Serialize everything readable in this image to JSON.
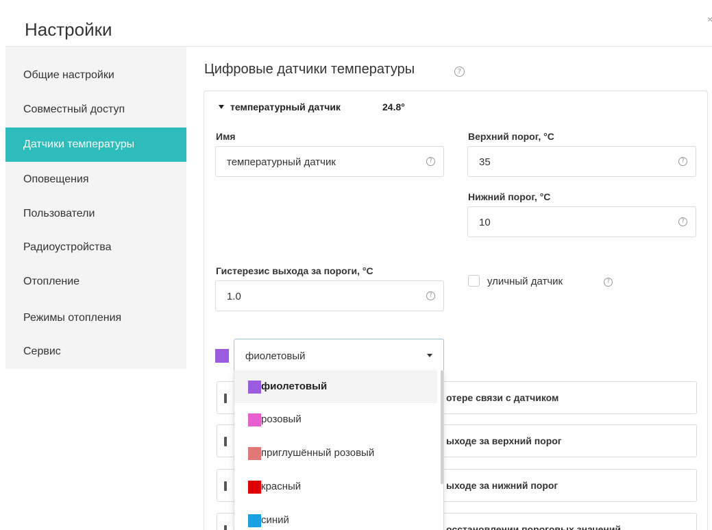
{
  "dialog": {
    "title": "Настройки",
    "close_icon": "close-icon"
  },
  "sidebar": {
    "items": [
      {
        "label": "Общие настройки",
        "active": false
      },
      {
        "label": "Совместный доступ",
        "active": false
      },
      {
        "label": "Датчики температуры",
        "active": true
      },
      {
        "label": "Оповещения",
        "active": false
      },
      {
        "label": "Пользователи",
        "active": false
      },
      {
        "label": "Радиоустройства",
        "active": false
      },
      {
        "label": "Отопление",
        "active": false
      },
      {
        "label": "Режимы отопления",
        "active": false
      },
      {
        "label": "Сервис",
        "active": false
      }
    ],
    "active_color": "#2dbdbd"
  },
  "main": {
    "title": "Цифровые датчики температуры",
    "sensor": {
      "name_header": "температурный датчик",
      "temperature": "24.8°",
      "name_label": "Имя",
      "name_value": "температурный датчик",
      "upper_label": "Верхний порог, °C",
      "upper_value": "35",
      "lower_label": "Нижний порог, °C",
      "lower_value": "10",
      "hysteresis_label": "Гистерезис выхода за пороги, °C",
      "hysteresis_value": "1.0",
      "outdoor_label": "уличный датчик",
      "outdoor_checked": false,
      "color_value": "фиолетовый",
      "color_hex": "#9c5ce0"
    },
    "notifications": [
      {
        "label": "отере связи с датчиком"
      },
      {
        "label": "ыходе за верхний порог"
      },
      {
        "label": "ыходе за нижний порог"
      },
      {
        "label": "осстановлении пороговых значений"
      }
    ],
    "color_options": [
      {
        "label": "фиолетовый",
        "hex": "#9c5ce0",
        "selected": true
      },
      {
        "label": "розовый",
        "hex": "#e85fd0",
        "selected": false
      },
      {
        "label": "приглушённый розовый",
        "hex": "#e07878",
        "selected": false
      },
      {
        "label": "красный",
        "hex": "#e00000",
        "selected": false
      },
      {
        "label": "синий",
        "hex": "#1aa0e0",
        "selected": false
      }
    ]
  }
}
